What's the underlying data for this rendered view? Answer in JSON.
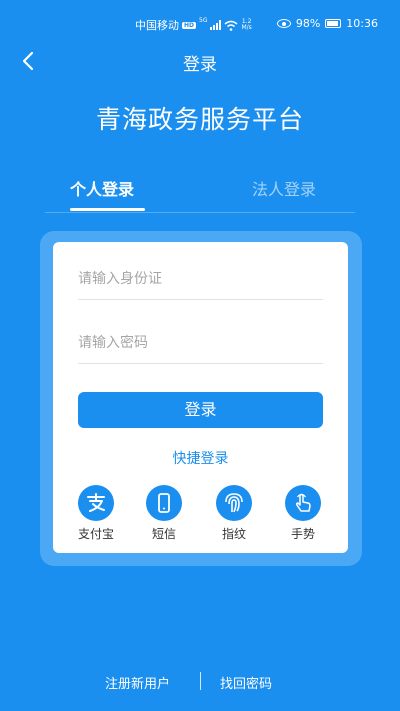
{
  "status_bar": {
    "carrier": "中国移动",
    "hd_badge": "HD",
    "network": "5G",
    "speed_value": "1.2",
    "speed_unit": "M/s",
    "battery": "98%",
    "time": "10:36"
  },
  "header": {
    "title": "登录",
    "platform_title": "青海政务服务平台"
  },
  "tabs": {
    "personal": "个人登录",
    "legal": "法人登录"
  },
  "form": {
    "id_placeholder": "请输入身份证",
    "password_placeholder": "请输入密码",
    "login_label": "登录",
    "quick_login_label": "快捷登录"
  },
  "quick_options": [
    {
      "label": "支付宝",
      "icon": "alipay-icon"
    },
    {
      "label": "短信",
      "icon": "phone-icon"
    },
    {
      "label": "指纹",
      "icon": "fingerprint-icon"
    },
    {
      "label": "手势",
      "icon": "gesture-icon"
    }
  ],
  "footer": {
    "register": "注册新用户",
    "forgot_password": "找回密码"
  },
  "colors": {
    "primary": "#1b8ff0",
    "card_frame": "#4aa8f4"
  }
}
